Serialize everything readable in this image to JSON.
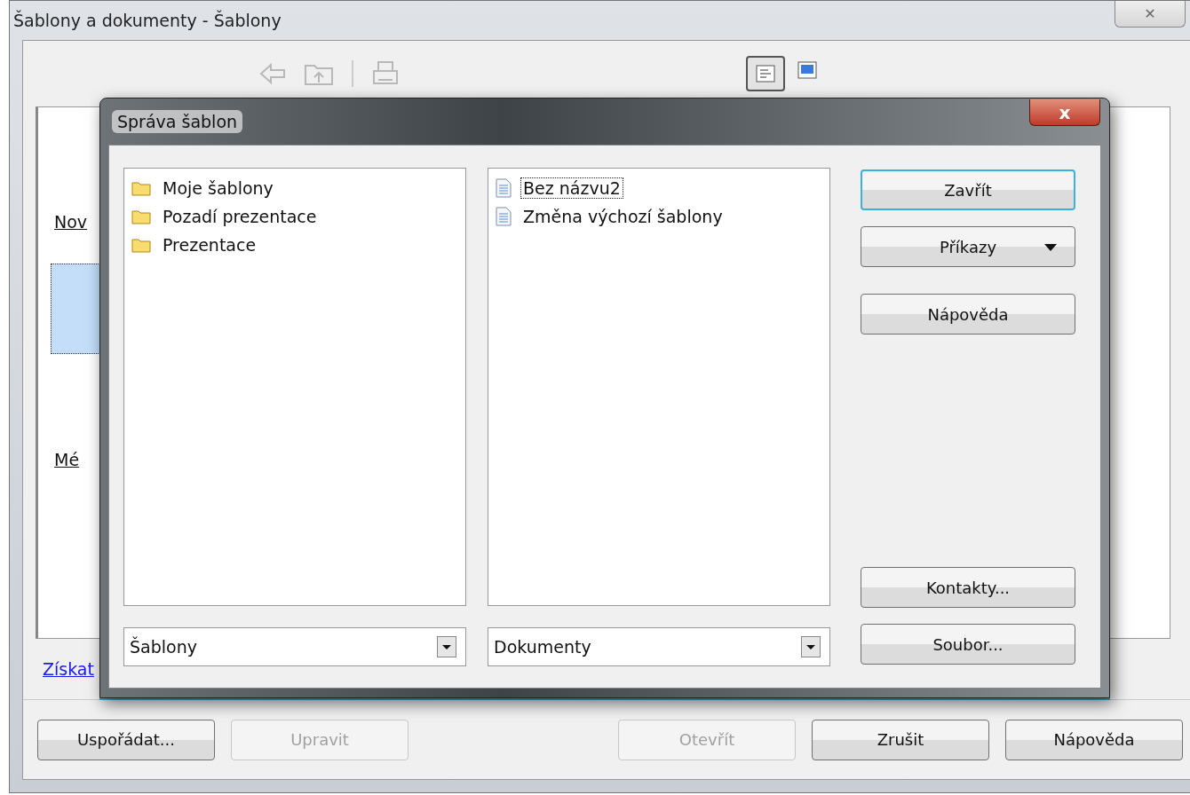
{
  "back_window": {
    "title": "Šablony a dokumenty - Šablony",
    "close": "✕",
    "toolbar": [
      {
        "kind": "back",
        "disabled": true
      },
      {
        "kind": "folder_up",
        "disabled": true
      },
      {
        "kind": "separator"
      },
      {
        "kind": "print",
        "disabled": true
      }
    ],
    "view_buttons": [
      {
        "kind": "details",
        "pressed": true
      },
      {
        "kind": "preview",
        "pressed": false
      }
    ],
    "categories": [
      {
        "label": "Nov",
        "kind": "label"
      },
      {
        "kind": "icon",
        "selected": true
      },
      {
        "label": "Mé",
        "kind": "label"
      }
    ],
    "link": "Získat",
    "buttons": [
      {
        "label": "Uspořádat...",
        "disabled": false
      },
      {
        "label": "Upravit",
        "disabled": true
      },
      {
        "kind": "spacer"
      },
      {
        "label": "Otevřít",
        "disabled": true
      },
      {
        "label": "Zrušit",
        "disabled": false
      },
      {
        "label": "Nápověda",
        "disabled": false
      }
    ]
  },
  "dialog": {
    "title": "Správa šablon",
    "close": "x",
    "left_list": {
      "items": [
        {
          "label": "Moje šablony",
          "kind": "folder",
          "selected": false
        },
        {
          "label": "Pozadí prezentace",
          "kind": "folder",
          "selected": false
        },
        {
          "label": "Prezentace",
          "kind": "folder",
          "selected": false
        }
      ],
      "combo": "Šablony"
    },
    "right_list": {
      "items": [
        {
          "label": "Bez názvu2",
          "kind": "document",
          "selected": true
        },
        {
          "label": "Změna výchozí šablony",
          "kind": "document",
          "selected": false
        }
      ],
      "combo": "Dokumenty"
    },
    "buttons": [
      {
        "label": "Zavřít",
        "default": true,
        "menu": false
      },
      {
        "label": "Příkazy",
        "default": false,
        "menu": true
      },
      {
        "label": "Nápověda",
        "default": false,
        "menu": false
      },
      {
        "kind": "spacer"
      },
      {
        "label": "Kontakty...",
        "default": false,
        "menu": false
      },
      {
        "label": "Soubor...",
        "default": false,
        "menu": false
      }
    ]
  }
}
